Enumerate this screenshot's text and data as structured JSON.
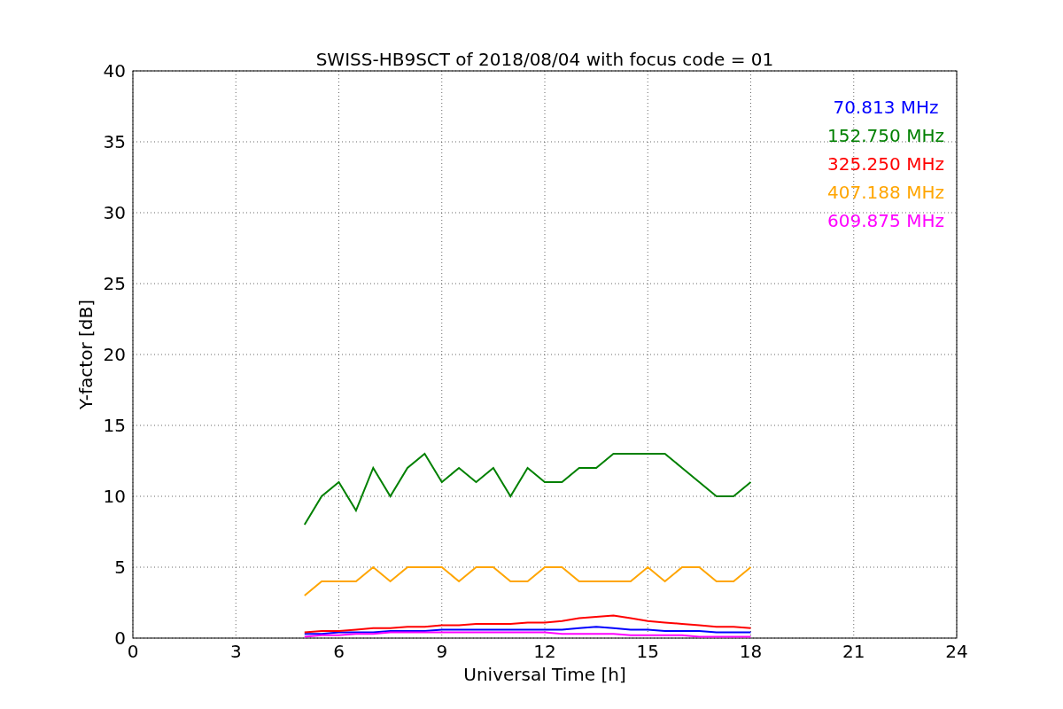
{
  "chart_data": {
    "type": "line",
    "title": "SWISS-HB9SCT of 2018/08/04 with focus code = 01",
    "xlabel": "Universal Time [h]",
    "ylabel": "Y-factor [dB]",
    "x": [
      5,
      5.5,
      6,
      6.5,
      7,
      7.5,
      8,
      8.5,
      9,
      9.5,
      10,
      10.5,
      11,
      11.5,
      12,
      12.5,
      13,
      13.5,
      14,
      14.5,
      15,
      15.5,
      16,
      16.5,
      17,
      17.5,
      18
    ],
    "series": [
      {
        "name": "70.813 MHz",
        "color": "#0000ff",
        "values": [
          0.3,
          0.3,
          0.4,
          0.4,
          0.4,
          0.5,
          0.5,
          0.5,
          0.6,
          0.6,
          0.6,
          0.6,
          0.6,
          0.6,
          0.6,
          0.6,
          0.7,
          0.8,
          0.7,
          0.6,
          0.6,
          0.5,
          0.5,
          0.5,
          0.4,
          0.4,
          0.4
        ]
      },
      {
        "name": "152.750 MHz",
        "color": "#008000",
        "values": [
          8,
          10,
          11,
          9,
          12,
          10,
          12,
          13,
          11,
          12,
          11,
          12,
          10,
          12,
          11,
          11,
          12,
          12,
          13,
          13,
          13,
          13,
          12,
          11,
          10,
          10,
          11
        ]
      },
      {
        "name": "325.250 MHz",
        "color": "#ff0000",
        "values": [
          0.4,
          0.5,
          0.5,
          0.6,
          0.7,
          0.7,
          0.8,
          0.8,
          0.9,
          0.9,
          1.0,
          1.0,
          1.0,
          1.1,
          1.1,
          1.2,
          1.4,
          1.5,
          1.6,
          1.4,
          1.2,
          1.1,
          1.0,
          0.9,
          0.8,
          0.8,
          0.7
        ]
      },
      {
        "name": "407.188 MHz",
        "color": "#ffa500",
        "values": [
          3,
          4,
          4,
          4,
          5,
          4,
          5,
          5,
          5,
          4,
          5,
          5,
          4,
          4,
          5,
          5,
          4,
          4,
          4,
          4,
          5,
          4,
          5,
          5,
          4,
          4,
          5
        ]
      },
      {
        "name": "609.875 MHz",
        "color": "#ff00ff",
        "values": [
          0.1,
          0.2,
          0.2,
          0.3,
          0.3,
          0.4,
          0.4,
          0.4,
          0.4,
          0.4,
          0.4,
          0.4,
          0.4,
          0.4,
          0.4,
          0.3,
          0.3,
          0.3,
          0.3,
          0.2,
          0.2,
          0.2,
          0.2,
          0.1,
          0.1,
          0.1,
          0.1
        ]
      }
    ],
    "xlim": [
      0,
      24
    ],
    "ylim": [
      0,
      40
    ],
    "xticks": [
      0,
      3,
      6,
      9,
      12,
      15,
      18,
      21,
      24
    ],
    "yticks": [
      0,
      5,
      10,
      15,
      20,
      25,
      30,
      35,
      40
    ],
    "grid": true
  }
}
